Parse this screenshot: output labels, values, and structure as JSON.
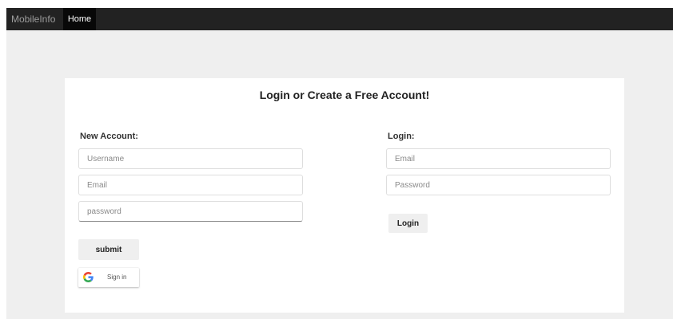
{
  "navbar": {
    "brand": "MobileInfo",
    "items": [
      {
        "label": "Home",
        "active": true
      }
    ]
  },
  "card": {
    "title": "Login or Create a Free Account!"
  },
  "new_account": {
    "heading": "New Account:",
    "username_placeholder": "Username",
    "email_placeholder": "Email",
    "password_placeholder": "password",
    "submit_label": "submit"
  },
  "google_signin": {
    "icon": "google-g-icon",
    "label": "Sign in"
  },
  "login": {
    "heading": "Login:",
    "email_placeholder": "Email",
    "password_placeholder": "Password",
    "button_label": "Login"
  },
  "colors": {
    "navbar_bg": "#222222",
    "active_tab_bg": "#080808",
    "page_bg": "#efefef",
    "card_bg": "#ffffff",
    "button_bg": "#efefef"
  }
}
